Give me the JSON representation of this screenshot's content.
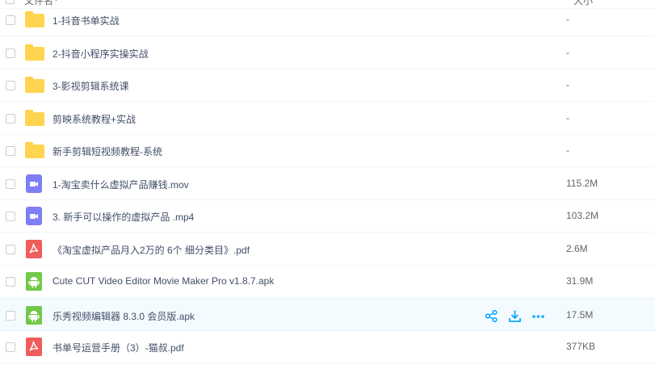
{
  "header": {
    "name_label": "文件名",
    "sort_icon": "+",
    "size_label": "大小"
  },
  "files": [
    {
      "name": "1-抖音书单实战",
      "size": "-",
      "type": "folder"
    },
    {
      "name": "2-抖音小程序实操实战",
      "size": "-",
      "type": "folder"
    },
    {
      "name": "3-影视剪辑系统课",
      "size": "-",
      "type": "folder"
    },
    {
      "name": "剪映系统教程+实战",
      "size": "-",
      "type": "folder"
    },
    {
      "name": "新手剪辑短视频教程-系统",
      "size": "-",
      "type": "folder"
    },
    {
      "name": "1-淘宝卖什么虚拟产品赚钱.mov",
      "size": "115.2M",
      "type": "video"
    },
    {
      "name": "3. 新手可以操作的虚拟产品 .mp4",
      "size": "103.2M",
      "type": "video"
    },
    {
      "name": "《淘宝虚拟产品月入2万的 6个 细分类目》.pdf",
      "size": "2.6M",
      "type": "pdf"
    },
    {
      "name": "Cute CUT Video Editor Movie Maker Pro v1.8.7.apk",
      "size": "31.9M",
      "type": "apk"
    },
    {
      "name": "乐秀视频编辑器 8.3.0 会员版.apk",
      "size": "17.5M",
      "type": "apk"
    },
    {
      "name": "书单号运营手册（3）-猫叔.pdf",
      "size": "377KB",
      "type": "pdf"
    }
  ],
  "hover_row_actions": [
    "share-icon",
    "download-icon",
    "more-icon"
  ],
  "colors": {
    "accent": "#09aaff",
    "folder": "#ffd54f",
    "video": "#7e7ef6",
    "pdf": "#f05d5d",
    "apk": "#72c84a"
  }
}
